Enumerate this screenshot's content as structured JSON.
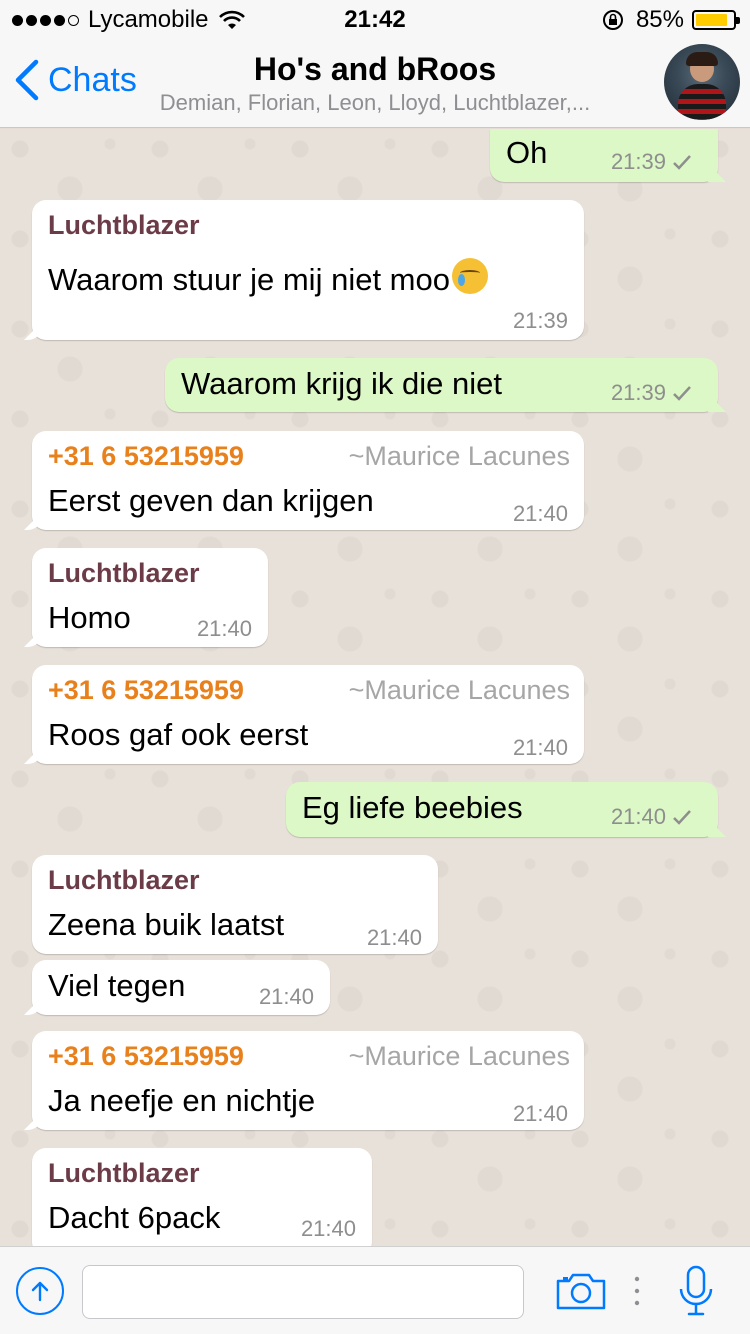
{
  "status_bar": {
    "carrier": "Lycamobile",
    "time": "21:42",
    "battery_percent": "85%",
    "battery_level": 0.85,
    "signal_bars": 4,
    "battery_color": "#ffcc00"
  },
  "header": {
    "back_label": "Chats",
    "title": "Ho's and bRoos",
    "members": "Demian, Florian, Leon, Lloyd, Luchtblazer,..."
  },
  "messages": [
    {
      "text": "Oh",
      "time": "21:39"
    },
    {
      "sender": "Luchtblazer",
      "text": "Waarom stuur je mij niet moo",
      "time": "21:39",
      "emoji": "crying-face"
    },
    {
      "text": "Waarom krijg ik die niet",
      "time": "21:39"
    },
    {
      "sender": "+31 6 53215959",
      "alias": "~Maurice Lacunes",
      "text": "Eerst geven dan krijgen",
      "time": "21:40"
    },
    {
      "sender": "Luchtblazer",
      "text": "Homo",
      "time": "21:40"
    },
    {
      "sender": "+31 6 53215959",
      "alias": "~Maurice Lacunes",
      "text": "Roos gaf ook eerst",
      "time": "21:40"
    },
    {
      "text": "Eg liefe beebies",
      "time": "21:40"
    },
    {
      "sender": "Luchtblazer",
      "text": "Zeena buik laatst",
      "time": "21:40"
    },
    {
      "text": "Viel tegen",
      "time": "21:40"
    },
    {
      "sender": "+31 6 53215959",
      "alias": "~Maurice Lacunes",
      "text": "Ja neefje en nichtje",
      "time": "21:40"
    },
    {
      "sender": "Luchtblazer",
      "text": "Dacht 6pack",
      "time": "21:40"
    }
  ],
  "colors": {
    "outgoing_bubble": "#dcf8c6",
    "incoming_bubble": "#ffffff",
    "sender_luchtblazer": "#6b3b48",
    "sender_phone": "#e8801c",
    "accent": "#007aff"
  },
  "input": {
    "placeholder": "",
    "value": ""
  }
}
